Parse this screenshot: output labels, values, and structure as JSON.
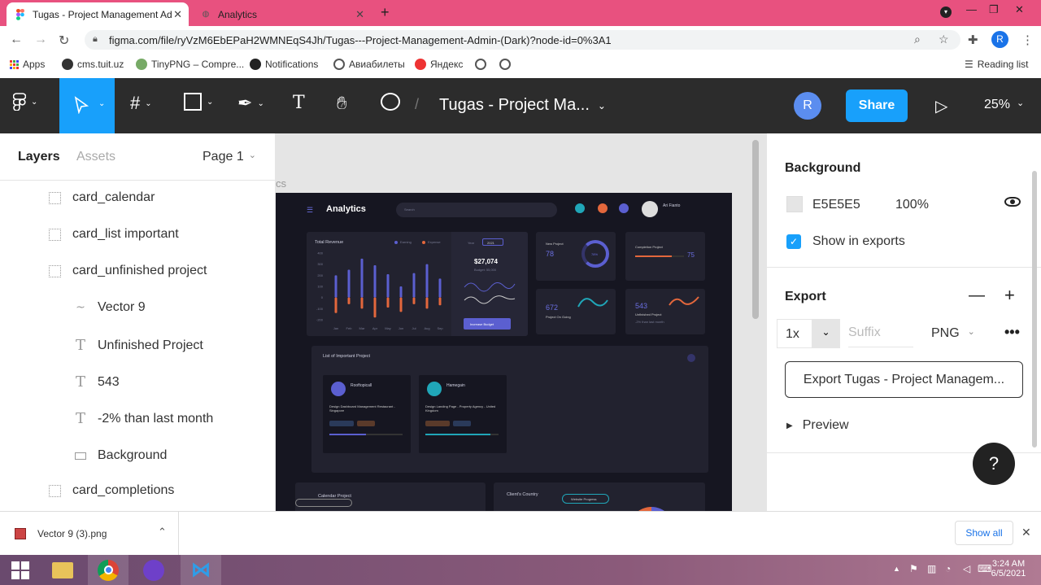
{
  "browser": {
    "tabs": [
      {
        "title": "Tugas - Project Management Ad",
        "active": true
      },
      {
        "title": "Analytics",
        "active": false
      }
    ],
    "url": "figma.com/file/ryVzM6EbEPaH2WMNEqS4Jh/Tugas---Project-Management-Admin-(Dark)?node-id=0%3A1",
    "profile_initial": "R",
    "bookmarks": [
      "Apps",
      "cms.tuit.uz",
      "TinyPNG – Compre...",
      "Notifications",
      "Авиабилеты",
      "Яндекс"
    ],
    "reading_list": "Reading list"
  },
  "figma": {
    "file_title": "Tugas - Project Ma...",
    "avatar_initial": "R",
    "share_label": "Share",
    "zoom": "25%",
    "left_panel": {
      "tabs": [
        "Layers",
        "Assets"
      ],
      "page": "Page 1",
      "layers": [
        {
          "name": "card_calendar",
          "type": "frame",
          "indent": 0
        },
        {
          "name": "card_list important",
          "type": "frame",
          "indent": 0
        },
        {
          "name": "card_unfinished project",
          "type": "frame",
          "indent": 0
        },
        {
          "name": "Vector 9",
          "type": "vector",
          "indent": 1
        },
        {
          "name": "Unfinished Project",
          "type": "text",
          "indent": 1
        },
        {
          "name": "543",
          "type": "text",
          "indent": 1
        },
        {
          "name": "-2% than last month",
          "type": "text",
          "indent": 1
        },
        {
          "name": "Background",
          "type": "rect",
          "indent": 1
        },
        {
          "name": "card_completions",
          "type": "frame",
          "indent": 0
        }
      ]
    },
    "canvas": {
      "frame_label_fragment": "cs",
      "design": {
        "title": "Analytics",
        "search_placeholder": "Search",
        "user_name": "Ari Fianto",
        "revenue_title": "Total Revenue",
        "legend": [
          "Earning",
          "Expense"
        ],
        "months": [
          "Jan",
          "Feb",
          "Mar",
          "Apr",
          "May",
          "Jun",
          "Jul",
          "Aug",
          "Sep"
        ],
        "y_ticks": [
          "400",
          "300",
          "200",
          "100",
          "0",
          "-100",
          "-200"
        ],
        "year_label": "Year",
        "year_value": "2021",
        "amount": "$27,074",
        "budget": "Budget: 55,000",
        "budget_button": "Increase Budget",
        "new_project": {
          "label": "New Project",
          "value": "78",
          "pct": "78%"
        },
        "completion_project": {
          "label": "Completion Project",
          "value": "75"
        },
        "ongoing": {
          "label": "Project On Going",
          "value": "672"
        },
        "unfinished": {
          "label": "Unfinished Project",
          "value": "543",
          "note": "-2% than last month"
        },
        "list_title": "List of Important Project",
        "projects": [
          {
            "name": "Rooftopicall",
            "task": "Design Dashboard Management Restaurant - Singapore"
          },
          {
            "name": "Hamegain",
            "task": "Design Landing Page - Property Agency - United Kingdom"
          }
        ],
        "calendar_title": "Calendar Project",
        "country_title": "Client's Country",
        "country_button": "Website Progress"
      }
    },
    "right_panel": {
      "background_title": "Background",
      "bg_color": "E5E5E5",
      "bg_opacity": "100%",
      "show_in_exports": "Show in exports",
      "export_title": "Export",
      "scale": "1x",
      "suffix_placeholder": "Suffix",
      "format": "PNG",
      "export_button": "Export Tugas - Project Managem...",
      "preview_label": "Preview",
      "help_label": "?"
    }
  },
  "downloads": {
    "file": "Vector 9 (3).png",
    "show_all": "Show all"
  },
  "taskbar": {
    "time": "3:24 AM",
    "date": "6/5/2021"
  },
  "chart_data": {
    "type": "bar",
    "title": "Total Revenue",
    "categories": [
      "Jan",
      "Feb",
      "Mar",
      "Apr",
      "May",
      "Jun",
      "Jul",
      "Aug",
      "Sep"
    ],
    "series": [
      {
        "name": "Earning",
        "values": [
          200,
          250,
          350,
          290,
          210,
          100,
          220,
          300,
          170
        ]
      },
      {
        "name": "Expense",
        "values": [
          -140,
          -60,
          -100,
          -180,
          -90,
          -130,
          -60,
          -100,
          -70
        ]
      }
    ],
    "ylim": [
      -200,
      400
    ],
    "colors": {
      "Earning": "#5b5fd0",
      "Expense": "#e3673c"
    }
  }
}
